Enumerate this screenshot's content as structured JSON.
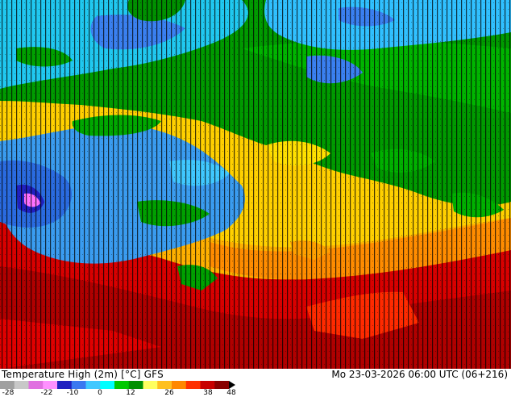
{
  "map": {
    "title": "Temperature High (2m) [°C] GFS",
    "datetime": "Mo 23-03-2026 06:00 UTC (06+216)",
    "legend_ticks": [
      "-28",
      "-22",
      "-10",
      "0",
      "12",
      "26",
      "38",
      "48"
    ],
    "legend_colors": [
      "#a0a0a0",
      "#c8c8c8",
      "#e070e0",
      "#ff90ff",
      "#2020c0",
      "#3a78f0",
      "#40c8ff",
      "#00ffff",
      "#00c800",
      "#009000",
      "#ffff60",
      "#ffc020",
      "#ff8800",
      "#ff3000",
      "#c80000",
      "#880000"
    ]
  }
}
